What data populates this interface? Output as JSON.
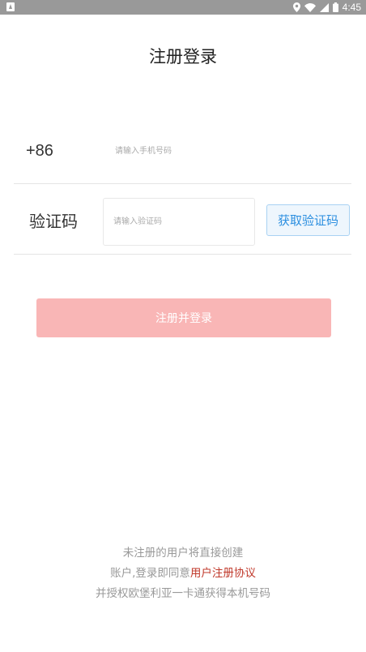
{
  "status_bar": {
    "time": "4:45",
    "icons": [
      "notification-a-icon",
      "location-icon",
      "wifi-icon",
      "cell-signal-icon",
      "battery-icon"
    ]
  },
  "title": "注册登录",
  "phone": {
    "country_code": "+86",
    "placeholder": "请输入手机号码",
    "value": ""
  },
  "code": {
    "label": "验证码",
    "placeholder": "请输入验证码",
    "value": "",
    "button_label": "获取验证码"
  },
  "submit_label": "注册并登录",
  "footer": {
    "line1": "未注册的用户将直接创建",
    "line2_prefix": "账户,登录即同意",
    "agreement_link": "用户注册协议",
    "line3": "并授权欧堡利亚一卡通获得本机号码"
  },
  "colors": {
    "status_bar": "#999999",
    "submit_bg": "#f9b6b6",
    "link": "#c0392b",
    "code_button_text": "#2c8fe0",
    "code_button_bg": "#eef6fd",
    "code_button_border": "#a9d2f3"
  }
}
